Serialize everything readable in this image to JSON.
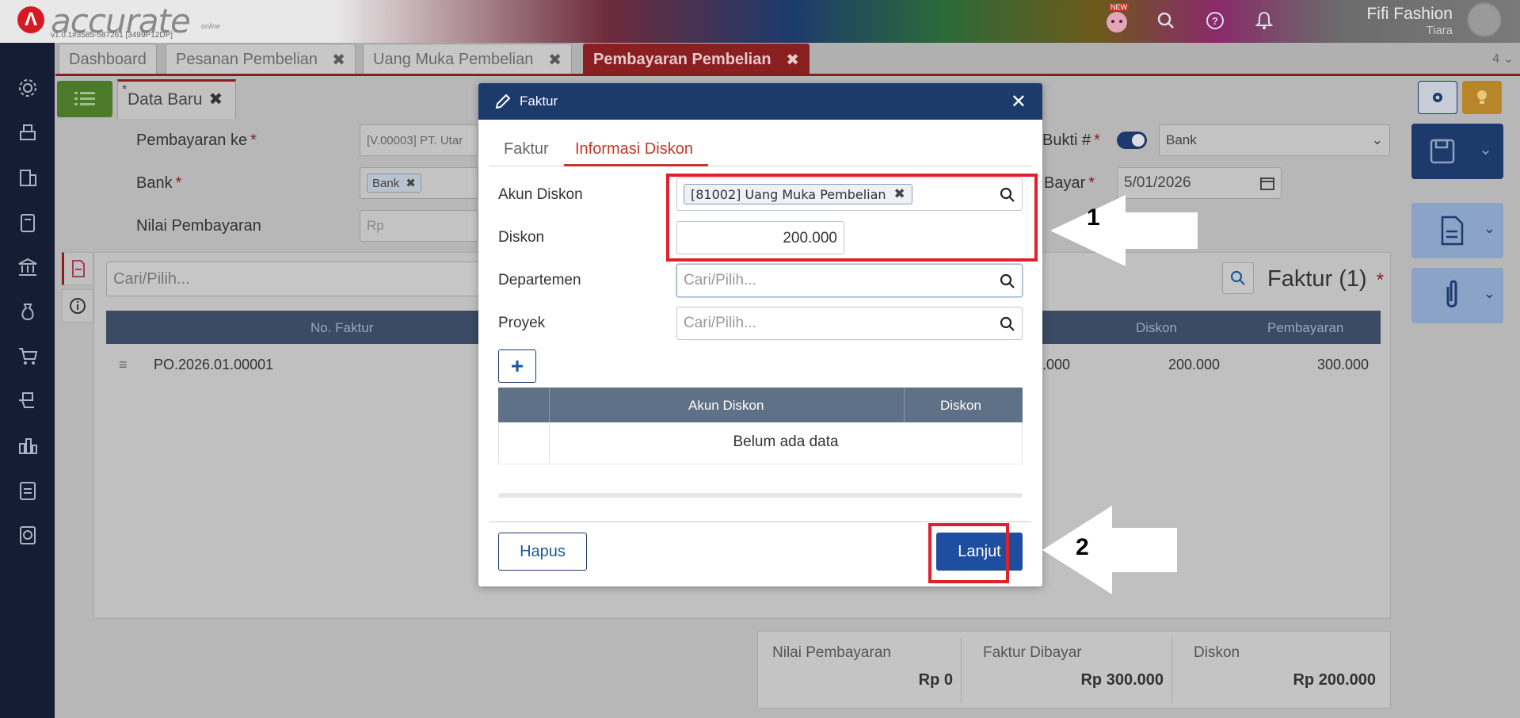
{
  "app": {
    "logo_text": "accurate",
    "logo_sub": "v1.0.1#3585-587261 [3499P12DP]",
    "logo_online": "online",
    "new_badge": "NEW",
    "user_name": "Fifi Fashion",
    "user_role": "Tiara"
  },
  "tabs": [
    {
      "label": "Dashboard"
    },
    {
      "label": "Pesanan Pembelian"
    },
    {
      "label": "Uang Muka Pembelian"
    },
    {
      "label": "Pembayaran Pembelian"
    }
  ],
  "tabs_count": "4",
  "doc_tab": {
    "label": "Data Baru",
    "marker": "*"
  },
  "form": {
    "pembayaran_ke_label": "Pembayaran ke",
    "pembayaran_ke_value": "[V.00003] PT. Utar",
    "bank_label": "Bank",
    "bank_chip": "Bank",
    "nilai_label": "Nilai Pembayaran",
    "nilai_placeholder": "Rp",
    "bukti_label": "Bukti #",
    "bukti_select": "Bank",
    "tgl_label": "l Bayar",
    "tgl_value": "5/01/2026",
    "required_mark": "*"
  },
  "panel": {
    "search_placeholder": "Cari/Pilih...",
    "title": "Faktur (1)",
    "columns": [
      "No. Faktur",
      "Diskon",
      "Pembayaran"
    ],
    "row": {
      "no_faktur": "PO.2026.01.00001",
      "partial": ".000",
      "diskon": "200.000",
      "pembayaran": "300.000"
    }
  },
  "summary": [
    {
      "label": "Nilai Pembayaran",
      "value": "Rp 0"
    },
    {
      "label": "Faktur Dibayar",
      "value": "Rp 300.000"
    },
    {
      "label": "Diskon",
      "value": "Rp 200.000"
    }
  ],
  "modal": {
    "title": "Faktur",
    "tabs": [
      "Faktur",
      "Informasi Diskon"
    ],
    "akun_diskon_label": "Akun Diskon",
    "akun_diskon_chip": "[81002] Uang Muka Pembelian",
    "diskon_label": "Diskon",
    "diskon_value": "200.000",
    "departemen_label": "Departemen",
    "departemen_placeholder": "Cari/Pilih...",
    "proyek_label": "Proyek",
    "proyek_placeholder": "Cari/Pilih...",
    "add_label": "+",
    "table_columns": [
      "Akun Diskon",
      "Diskon"
    ],
    "empty_text": "Belum ada data",
    "hapus_label": "Hapus",
    "lanjut_label": "Lanjut"
  },
  "annotations": [
    "1",
    "2"
  ],
  "colors": {
    "accent": "#c0392b",
    "navy": "#1d3a6d",
    "annotation_red": "#e0202a"
  },
  "icons": [
    "gear-icon",
    "printer-icon",
    "building-icon",
    "book-icon",
    "bank-icon",
    "money-bag-icon",
    "cart-icon",
    "cart-box-icon",
    "chart-building-icon",
    "tax-icon",
    "report-icon",
    "search-icon",
    "help-icon",
    "bell-icon",
    "list-icon",
    "save-icon",
    "document-icon",
    "paperclip-icon",
    "pencil-icon",
    "calendar-icon"
  ]
}
